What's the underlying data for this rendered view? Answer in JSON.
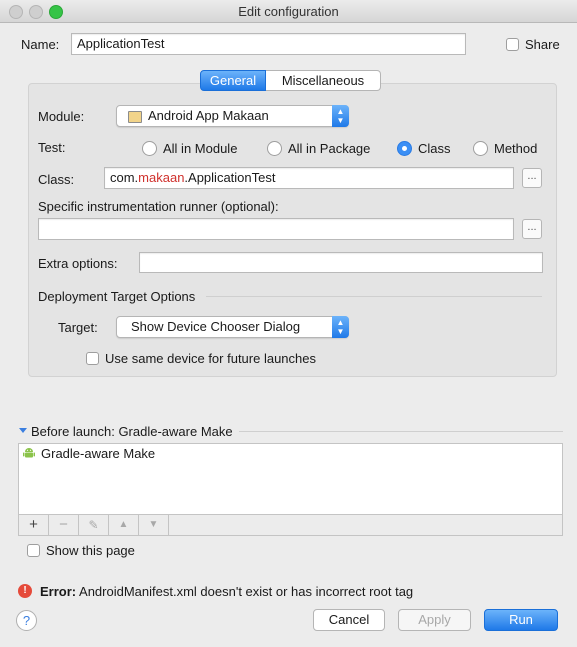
{
  "window": {
    "title": "Edit configuration"
  },
  "name_row": {
    "label": "Name:",
    "value": "ApplicationTest",
    "share_label": "Share"
  },
  "tabs": [
    {
      "label": "General",
      "selected": true
    },
    {
      "label": "Miscellaneous",
      "selected": false
    }
  ],
  "module": {
    "label": "Module:",
    "value": "Android App Makaan"
  },
  "test": {
    "label": "Test:",
    "options": [
      "All in Module",
      "All in Package",
      "Class",
      "Method"
    ],
    "selected": "Class"
  },
  "class_field": {
    "label": "Class:",
    "value_prefix": "com.",
    "value_highlight": "makaan",
    "value_suffix": ".ApplicationTest",
    "highlight_color": "#d0312d",
    "browse_label": "..."
  },
  "runner": {
    "label": "Specific instrumentation runner (optional):",
    "value": "",
    "browse_label": "..."
  },
  "extra": {
    "label": "Extra options:",
    "value": ""
  },
  "deployment": {
    "section_label": "Deployment Target Options",
    "target_label": "Target:",
    "target_value": "Show Device Chooser Dialog",
    "same_device_label": "Use same device for future launches"
  },
  "before_launch": {
    "header": "Before launch: Gradle-aware Make",
    "items": [
      "Gradle-aware Make"
    ],
    "toolbar": [
      "+",
      "−",
      "✎",
      "▲",
      "▼"
    ]
  },
  "show_page": {
    "label": "Show this page"
  },
  "error": {
    "prefix": "Error:",
    "message": "AndroidManifest.xml doesn't exist or has incorrect root tag"
  },
  "footer": {
    "help": "?",
    "cancel": "Cancel",
    "apply": "Apply",
    "run": "Run"
  },
  "colors": {
    "accent": "#1f79e8",
    "error": "#e54a3a",
    "android_green": "#8bc34a"
  }
}
